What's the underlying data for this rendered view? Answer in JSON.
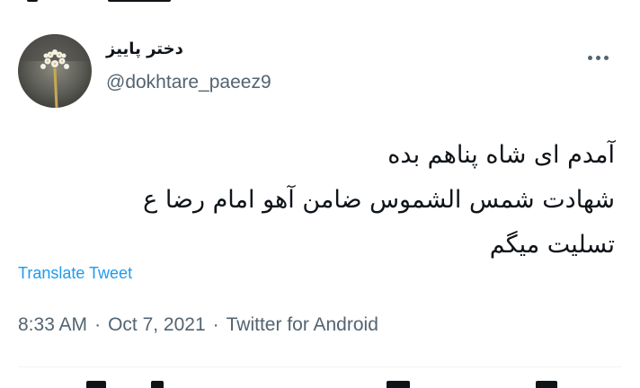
{
  "tweet": {
    "display_name": "دختر پاییز",
    "username": "@dokhtare_paeez9",
    "more_icon": "more-horizontal-icon",
    "text_lines": [
      "آمدم ای شاه پناهم بده",
      "شهادت شمس الشموس ضامن آهو امام رضا ع",
      "تسلیت میگم"
    ],
    "translate_label": "Translate Tweet",
    "time": "8:33 AM",
    "date": "Oct 7, 2021",
    "source": "Twitter for Android",
    "separator": "·"
  },
  "colors": {
    "text_primary": "#0f1419",
    "text_secondary": "#536471",
    "link": "#1d9bf0",
    "divider": "#eff3f4"
  }
}
